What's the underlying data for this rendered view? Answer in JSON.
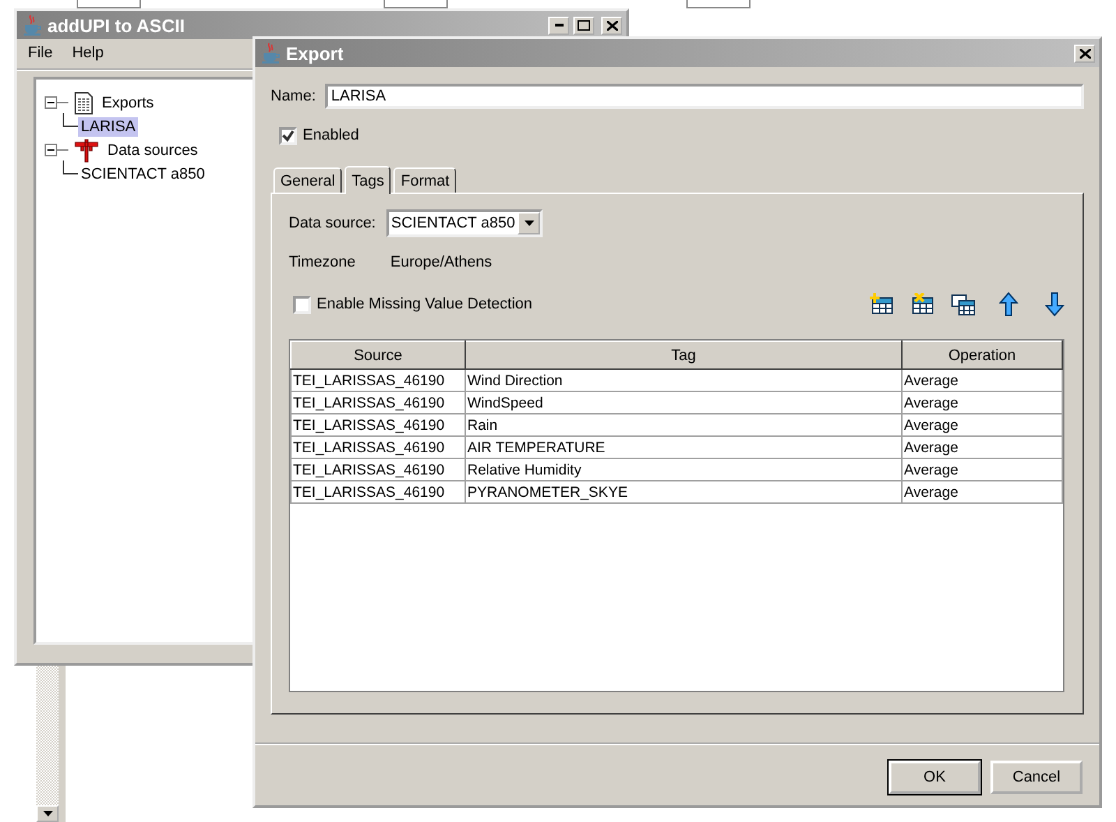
{
  "main_window": {
    "title": "addUPI to ASCII",
    "menu": [
      "File",
      "Help"
    ],
    "tree": [
      {
        "label": "Exports",
        "kind": "exports",
        "expanded": true,
        "selected": false,
        "children": [
          {
            "label": "LARISA",
            "selected": true
          }
        ]
      },
      {
        "label": "Data sources",
        "kind": "sources",
        "expanded": true,
        "selected": false,
        "children": [
          {
            "label": "SCIENTACT a850",
            "selected": false
          }
        ]
      }
    ]
  },
  "dialog": {
    "title": "Export",
    "name": {
      "label": "Name:",
      "value": "LARISA"
    },
    "enabled": {
      "label": "Enabled",
      "checked": true
    },
    "tabs": [
      {
        "label": "General",
        "selected": false
      },
      {
        "label": "Tags",
        "selected": true
      },
      {
        "label": "Format",
        "selected": false
      }
    ],
    "data_source": {
      "label": "Data source:",
      "value": "SCIENTACT a850"
    },
    "timezone": {
      "label": "Timezone",
      "value": "Europe/Athens"
    },
    "missing_value": {
      "label": "Enable Missing Value Detection",
      "checked": false
    },
    "table": {
      "columns": [
        "Source",
        "Tag",
        "Operation"
      ],
      "rows": [
        [
          "TEI_LARISSAS_46190",
          "Wind Direction",
          "Average"
        ],
        [
          "TEI_LARISSAS_46190",
          "WindSpeed",
          "Average"
        ],
        [
          "TEI_LARISSAS_46190",
          "Rain",
          "Average"
        ],
        [
          "TEI_LARISSAS_46190",
          "AIR TEMPERATURE",
          "Average"
        ],
        [
          "TEI_LARISSAS_46190",
          "Relative Humidity",
          "Average"
        ],
        [
          "TEI_LARISSAS_46190",
          "PYRANOMETER_SKYE",
          "Average"
        ]
      ]
    },
    "buttons": [
      "OK",
      "Cancel"
    ]
  }
}
